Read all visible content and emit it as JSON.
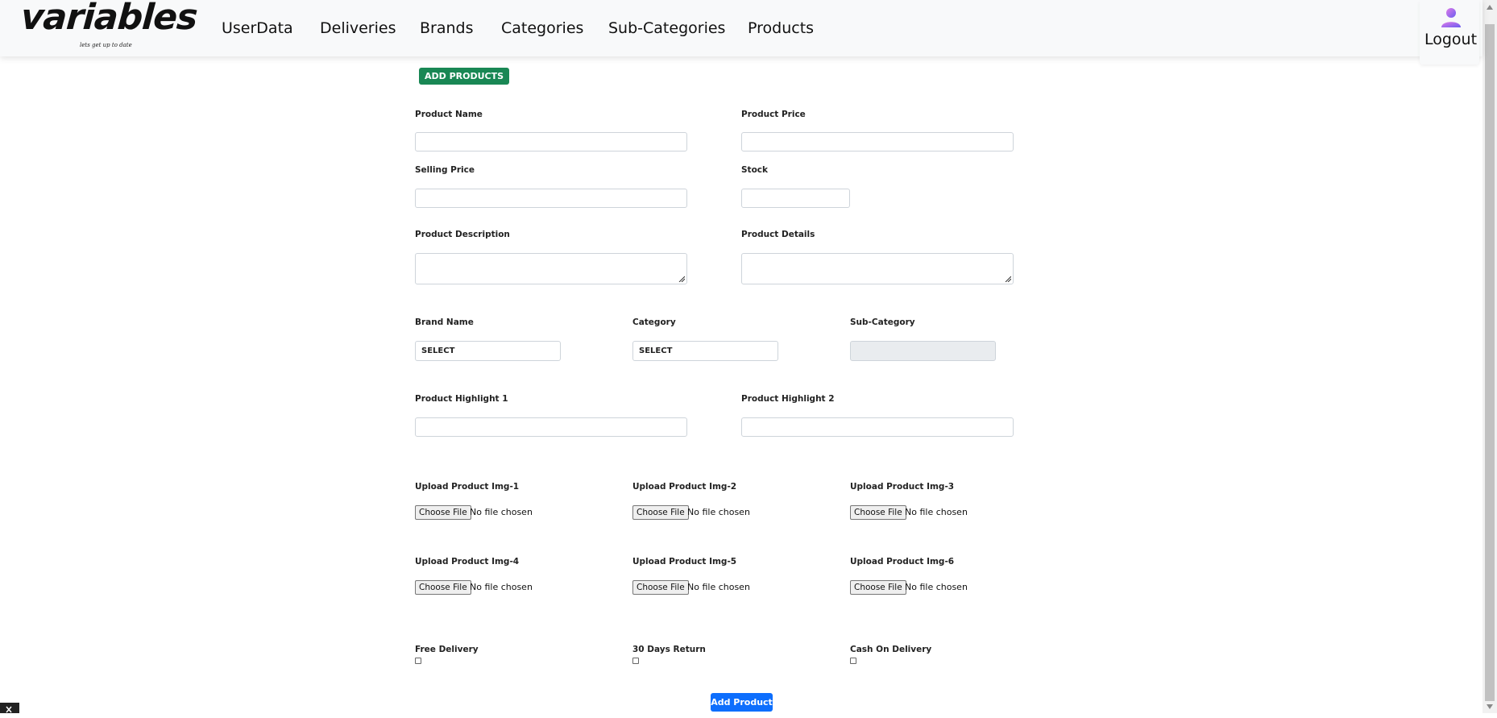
{
  "brand": {
    "name": "variables",
    "tagline": "lets get up to date"
  },
  "nav": {
    "items": [
      "UserData",
      "Deliveries",
      "Brands",
      "Categories",
      "Sub-Categories",
      "Products"
    ]
  },
  "user": {
    "logout_label": "Logout",
    "icon": "user-icon"
  },
  "form": {
    "header_badge": "ADD PRODUCTS",
    "product_name_label": "Product Name",
    "product_name_value": "",
    "product_price_label": "Product Price",
    "product_price_value": "",
    "selling_price_label": "Selling Price",
    "selling_price_value": "",
    "stock_label": "Stock",
    "stock_value": "",
    "description_label": "Product Description",
    "details_label": "Product Details",
    "brand_label": "Brand Name",
    "brand_value": "SELECT",
    "category_label": "Category",
    "category_value": "SELECT",
    "subcategory_label": "Sub-Category",
    "subcategory_value": "",
    "highlight1_label": "Product Highlight 1",
    "highlight2_label": "Product Highlight 2",
    "uploads": [
      {
        "label": "Upload Product Img-1",
        "button": "Choose File",
        "status": "No file chosen"
      },
      {
        "label": "Upload Product Img-2",
        "button": "Choose File",
        "status": "No file chosen"
      },
      {
        "label": "Upload Product Img-3",
        "button": "Choose File",
        "status": "No file chosen"
      },
      {
        "label": "Upload Product Img-4",
        "button": "Choose File",
        "status": "No file chosen"
      },
      {
        "label": "Upload Product Img-5",
        "button": "Choose File",
        "status": "No file chosen"
      },
      {
        "label": "Upload Product Img-6",
        "button": "Choose File",
        "status": "No file chosen"
      }
    ],
    "options": [
      {
        "label": "Free Delivery",
        "checked": false
      },
      {
        "label": "30 Days Return",
        "checked": false
      },
      {
        "label": "Cash On Delivery",
        "checked": false
      }
    ],
    "submit_label": "Add Product"
  },
  "colors": {
    "badge": "#198754",
    "submit": "#0d6efd",
    "navbar": "#f8f9fa"
  }
}
